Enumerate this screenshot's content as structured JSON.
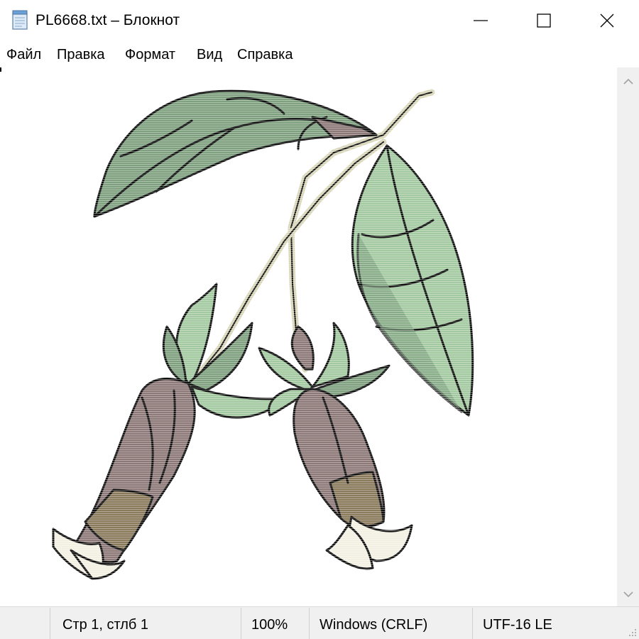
{
  "window": {
    "title": "PL6668.txt – Блокнот",
    "app_icon": "notepad-icon",
    "controls": [
      "minimize-icon",
      "maximize-icon",
      "close-icon"
    ]
  },
  "menu": [
    "Файл",
    "Правка",
    "Формат",
    "Вид",
    "Справка"
  ],
  "document": {
    "content": "ASCII art of a botanical illustration: a flowering branch with large green leaves and two drooping brownish-purple bell-shaped flowers"
  },
  "scrollbar": {
    "up_icon": "chevron-up-icon",
    "down_icon": "chevron-down-icon"
  },
  "status": {
    "position": "Стр 1, стлб 1",
    "zoom": "100%",
    "line_ending": "Windows (CRLF)",
    "encoding": "UTF-16 LE"
  },
  "colors": {
    "leaf_light": "#a3c9a0",
    "leaf_mid": "#7ea07f",
    "leaf_dark": "#5f8366",
    "flower_mauve": "#8d7878",
    "flower_brown": "#8a7a5c",
    "petal_cream": "#f2f0e2",
    "stem": "#d8d6b8",
    "outline": "#111111"
  }
}
